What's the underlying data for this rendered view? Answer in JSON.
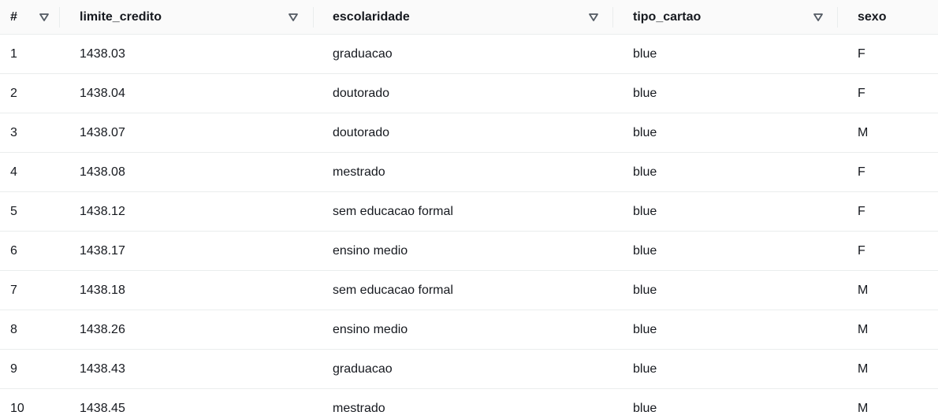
{
  "table": {
    "columns": [
      {
        "key": "index",
        "label": "#"
      },
      {
        "key": "limite_credito",
        "label": "limite_credito"
      },
      {
        "key": "escolaridade",
        "label": "escolaridade"
      },
      {
        "key": "tipo_cartao",
        "label": "tipo_cartao"
      },
      {
        "key": "sexo",
        "label": "sexo"
      }
    ],
    "sort_icon": "triangle-down-outline-icon",
    "rows": [
      [
        "1",
        "1438.03",
        "graduacao",
        "blue",
        "F"
      ],
      [
        "2",
        "1438.04",
        "doutorado",
        "blue",
        "F"
      ],
      [
        "3",
        "1438.07",
        "doutorado",
        "blue",
        "M"
      ],
      [
        "4",
        "1438.08",
        "mestrado",
        "blue",
        "F"
      ],
      [
        "5",
        "1438.12",
        "sem educacao formal",
        "blue",
        "F"
      ],
      [
        "6",
        "1438.17",
        "ensino medio",
        "blue",
        "F"
      ],
      [
        "7",
        "1438.18",
        "sem educacao formal",
        "blue",
        "M"
      ],
      [
        "8",
        "1438.26",
        "ensino medio",
        "blue",
        "M"
      ],
      [
        "9",
        "1438.43",
        "graduacao",
        "blue",
        "M"
      ],
      [
        "10",
        "1438.45",
        "mestrado",
        "blue",
        "M"
      ]
    ]
  },
  "colors": {
    "header_bg": "#fafafa",
    "border": "#eaeded",
    "text": "#16191f",
    "icon": "#545b64"
  }
}
